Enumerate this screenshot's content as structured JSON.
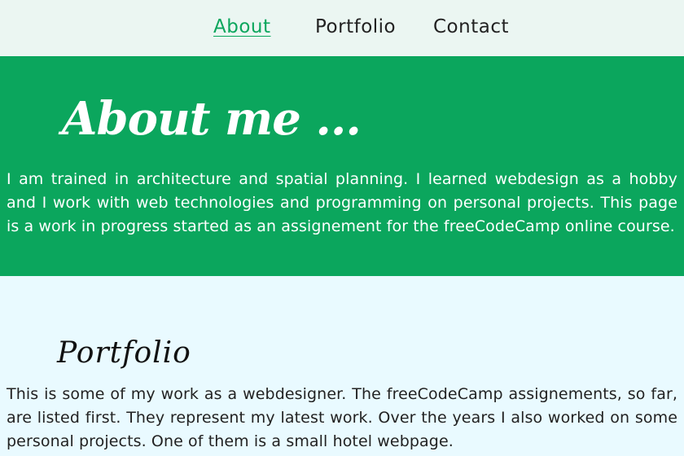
{
  "nav": {
    "items": [
      {
        "label": "About",
        "active": true
      },
      {
        "label": "Portfolio",
        "active": false
      },
      {
        "label": "Contact",
        "active": false
      }
    ]
  },
  "about": {
    "title": "About me ...",
    "text": "I am trained in architecture and spatial planning. I learned webdesign as a hobby and I work with web technologies and programming on personal projects. This page is a work in progress started as an assignement for the freeCodeCamp online course."
  },
  "portfolio": {
    "title": "Portfolio",
    "text": "This is some of my work as a webdesigner. The freeCodeCamp assignements, so far, are listed first. They represent my latest work. Over the years I also worked on some personal projects. One of them is a small hotel webpage."
  },
  "colors": {
    "accent": "#0ba65d",
    "nav_background": "#ebf6f2",
    "page_background": "#e9faff"
  }
}
